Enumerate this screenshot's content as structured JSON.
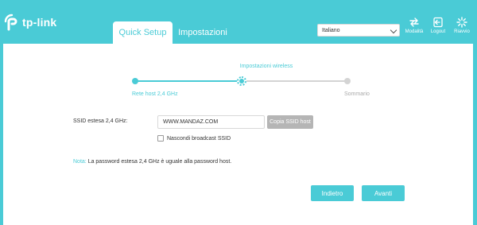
{
  "brand": {
    "logo_text": "tp-link"
  },
  "tabs": [
    {
      "label": "Quick Setup",
      "active": true
    },
    {
      "label": "Impostazioni",
      "active": false
    }
  ],
  "language": {
    "selected": "Italiano"
  },
  "header_buttons": [
    {
      "label": "Modalità",
      "icon": "mode-icon"
    },
    {
      "label": "Logout",
      "icon": "logout-icon"
    },
    {
      "label": "Riavvio",
      "icon": "reboot-icon"
    }
  ],
  "stepper": {
    "current_title": "Impostazioni wireless",
    "steps": [
      "Rete host 2,4 GHz",
      "Impostazioni wireless",
      "Sommario"
    ],
    "current_index": 1
  },
  "form": {
    "ssid_label": "SSID estesa 2,4 GHz:",
    "ssid_value": "WWW.MANDAZ.COM",
    "copy_button": "Copia SSID host",
    "hide_broadcast_label": "Nascondi broadcast SSID",
    "hide_broadcast_checked": false
  },
  "note": {
    "key": "Nota:",
    "text": "La password estesa 2,4 GHz è uguale alla password host."
  },
  "nav": {
    "back": "Indietro",
    "next": "Avanti"
  },
  "colors": {
    "accent": "#4acbd6",
    "inactive": "#d4d4d4",
    "disabled_button": "#b5b5b5"
  }
}
